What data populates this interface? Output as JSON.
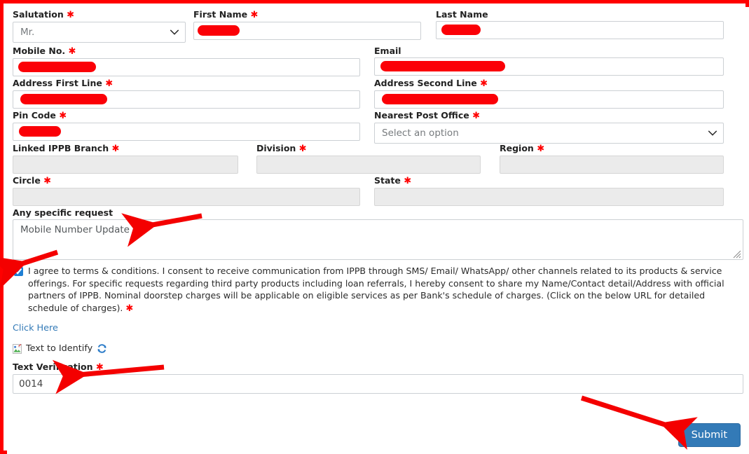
{
  "form": {
    "fields": {
      "salutation": {
        "label": "Salutation",
        "required": true,
        "value": "Mr.",
        "type": "select"
      },
      "first_name": {
        "label": "First Name",
        "required": true,
        "value": "",
        "redacted": true
      },
      "last_name": {
        "label": "Last Name",
        "required": false,
        "value": "",
        "redacted": true
      },
      "mobile_no": {
        "label": "Mobile No.",
        "required": true,
        "value": "",
        "redacted": true
      },
      "email": {
        "label": "Email",
        "required": false,
        "value": "",
        "redacted": true
      },
      "address_first_line": {
        "label": "Address First Line",
        "required": true,
        "value": "",
        "redacted": true
      },
      "address_second_line": {
        "label": "Address Second Line",
        "required": true,
        "value": "",
        "redacted": true
      },
      "pin_code": {
        "label": "Pin Code",
        "required": true,
        "value": "",
        "redacted": true
      },
      "nearest_post_office": {
        "label": "Nearest Post Office",
        "required": true,
        "value": "Select an option",
        "type": "select"
      },
      "linked_ippb_branch": {
        "label": "Linked IPPB Branch",
        "required": true,
        "value": "",
        "disabled": true
      },
      "division": {
        "label": "Division",
        "required": true,
        "value": "",
        "disabled": true
      },
      "region": {
        "label": "Region",
        "required": true,
        "value": "",
        "disabled": true
      },
      "circle": {
        "label": "Circle",
        "required": true,
        "value": "",
        "disabled": true
      },
      "state": {
        "label": "State",
        "required": true,
        "value": "",
        "disabled": true
      },
      "specific_request": {
        "label": "Any specific request",
        "required": false,
        "value": "Mobile Number Update",
        "type": "textarea"
      },
      "text_verification": {
        "label": "Text Verification",
        "required": true,
        "value": "0014"
      }
    },
    "terms": {
      "checked": true,
      "text": "I agree to terms & conditions. I consent to receive communication from IPPB through SMS/ Email/ WhatsApp/ other channels related to its products & service offerings. For specific requests regarding third party products including loan referrals, I hereby consent to share my Name/Contact detail/Address with official partners of IPPB. Nominal doorstep charges will be applicable on eligible services as per Bank's schedule of charges. (Click on the below URL for detailed schedule of charges).",
      "required_marker": "✱"
    },
    "click_here_link": "Click Here",
    "captcha": {
      "image_alt": "Text to Identify",
      "refresh_icon": "refresh-icon"
    },
    "submit_label": "Submit",
    "required_marker": "✱"
  },
  "colors": {
    "annotation_red": "#ff0000",
    "redaction_red": "#fb0007",
    "required_asterisk": "#ff0000",
    "submit_blue": "#337ab7",
    "link_blue": "#337ab7",
    "disabled_grey": "#ebebeb",
    "checkbox_blue": "#1f7fd4"
  },
  "annotations": [
    {
      "name": "arrow-to-specific-request",
      "direction": "left"
    },
    {
      "name": "arrow-to-terms-checkbox",
      "direction": "left-up"
    },
    {
      "name": "arrow-to-text-verification",
      "direction": "left"
    },
    {
      "name": "arrow-to-submit-button",
      "direction": "down-right"
    }
  ]
}
